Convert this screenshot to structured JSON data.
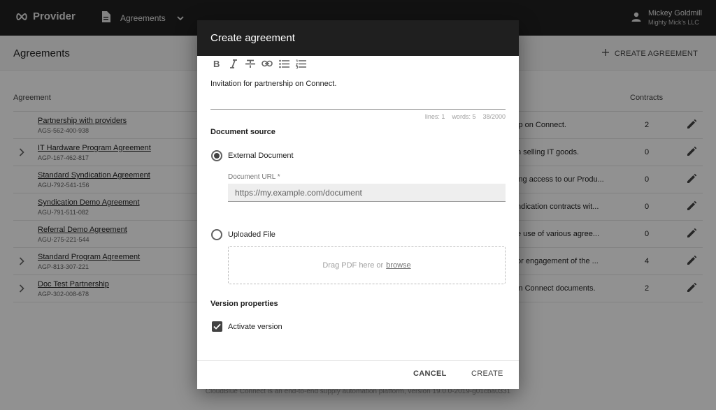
{
  "topbar": {
    "brand": "Provider",
    "section": "Agreements",
    "user_name": "Mickey Goldmill",
    "user_org": "Mighty Mick's LLC"
  },
  "page": {
    "title": "Agreements",
    "create_label": "CREATE AGREEMENT"
  },
  "table": {
    "col_agreement": "Agreement",
    "col_contracts": "Contracts",
    "rows": [
      {
        "name": "Partnership with providers",
        "code": "AGS-562-400-938",
        "desc": "ip on Connect.",
        "count": "2",
        "expandable": false
      },
      {
        "name": "IT Hardware Program Agreement",
        "code": "AGP-167-462-817",
        "desc": "n selling IT goods.",
        "count": "0",
        "expandable": true
      },
      {
        "name": "Standard Syndication Agreement",
        "code": "AGU-792-541-156",
        "desc": "ing access to our Produ...",
        "count": "0",
        "expandable": false
      },
      {
        "name": "Syndication Demo Agreement",
        "code": "AGU-791-511-082",
        "desc": "ndication contracts wit...",
        "count": "0",
        "expandable": false
      },
      {
        "name": "Referral Demo Agreement",
        "code": "AGU-275-221-544",
        "desc": "e use of various agree...",
        "count": "0",
        "expandable": false
      },
      {
        "name": "Standard Program Agreement",
        "code": "AGP-813-307-221",
        "desc": "or engagement of the ...",
        "count": "4",
        "expandable": true
      },
      {
        "name": "Doc Test Partnership",
        "code": "AGP-302-008-678",
        "desc": "in Connect documents.",
        "count": "2",
        "expandable": true
      }
    ]
  },
  "footer": "CloudBlue Connect is an end-to-end supply automation platform, version 19.0.0-2019-g01cba0331",
  "dialog": {
    "title": "Create agreement",
    "editor_text": "Invitation for partnership on Connect.",
    "stats": {
      "lines": "lines: 1",
      "words": "words: 5",
      "chars": "38/2000"
    },
    "doc_source_label": "Document source",
    "external_label": "External Document",
    "url_label": "Document URL *",
    "url_value": "https://my.example.com/document",
    "uploaded_label": "Uploaded File",
    "drop_text": "Drag PDF here or",
    "browse": "browse",
    "version_label": "Version properties",
    "activate_label": "Activate version",
    "cancel": "CANCEL",
    "create": "CREATE"
  },
  "colors": {
    "topbar": "#1f1f1f",
    "scrim": "rgba(0,0,0,0.42)"
  }
}
